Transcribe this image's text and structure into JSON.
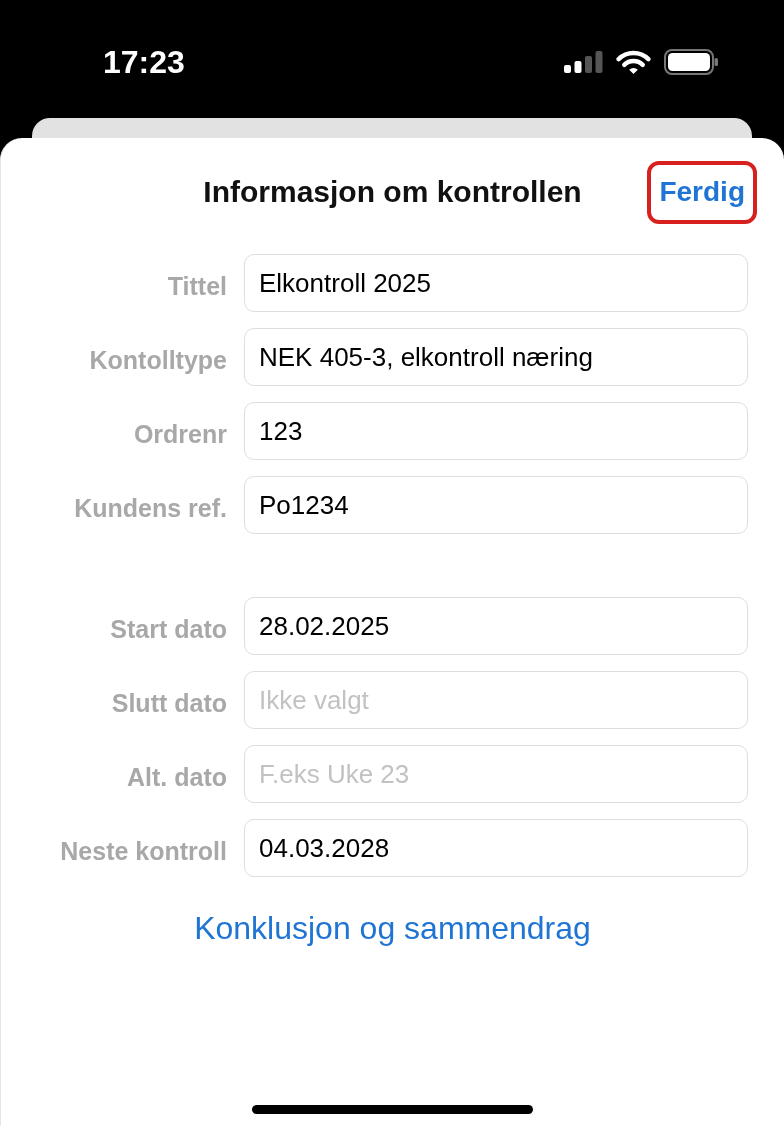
{
  "status_bar": {
    "time": "17:23"
  },
  "sheet": {
    "title": "Informasjon om kontrollen",
    "done_button": {
      "label": "Ferdig",
      "highlighted": true
    }
  },
  "form_groups": [
    {
      "fields": [
        {
          "label": "Tittel",
          "value": "Elkontroll 2025"
        },
        {
          "label": "Kontolltype",
          "value": "NEK 405-3, elkontroll næring"
        },
        {
          "label": "Ordrenr",
          "value": "123"
        },
        {
          "label": "Kundens ref.",
          "value": "Po1234"
        }
      ]
    },
    {
      "fields": [
        {
          "label": "Start dato",
          "value": "28.02.2025"
        },
        {
          "label": "Slutt dato",
          "placeholder": "Ikke valgt"
        },
        {
          "label": "Alt. dato",
          "placeholder": "F.eks Uke 23"
        },
        {
          "label": "Neste kontroll",
          "value": "04.03.2028"
        }
      ]
    }
  ],
  "link": "Konklusjon og sammendrag"
}
